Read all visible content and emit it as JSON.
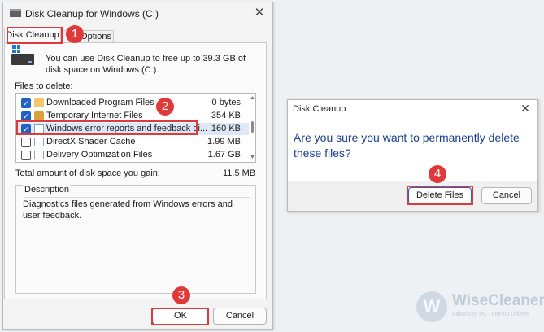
{
  "cleanup_window": {
    "title": "Disk Cleanup for Windows (C:)",
    "close_glyph": "✕",
    "tabs": [
      {
        "label": "Disk Cleanup",
        "active": true
      },
      {
        "label": "Options",
        "active": false
      }
    ],
    "intro_text": "You can use Disk Cleanup to free up to 39.3 GB of disk space on Windows (C:).",
    "files_to_delete_label": "Files to delete:",
    "files": [
      {
        "name": "Downloaded Program Files",
        "size": "0 bytes",
        "checked": true,
        "icon": "folder-icon"
      },
      {
        "name": "Temporary Internet Files",
        "size": "354 KB",
        "checked": true,
        "icon": "lock-icon"
      },
      {
        "name": "Windows error reports and feedback di...",
        "size": "160 KB",
        "checked": true,
        "icon": "page-icon",
        "selected": true
      },
      {
        "name": "DirectX Shader Cache",
        "size": "1.99 MB",
        "checked": false,
        "icon": "page-icon"
      },
      {
        "name": "Delivery Optimization Files",
        "size": "1.67 GB",
        "checked": false,
        "icon": "page-icon"
      }
    ],
    "total_label": "Total amount of disk space you gain:",
    "total_value": "11.5 MB",
    "description_legend": "Description",
    "description_text": "Diagnostics files generated from Windows errors and user feedback.",
    "ok_label": "OK",
    "cancel_label": "Cancel"
  },
  "confirm_dialog": {
    "title": "Disk Cleanup",
    "close_glyph": "✕",
    "question": "Are you sure you want to permanently delete these files?",
    "delete_label": "Delete Files",
    "cancel_label": "Cancel"
  },
  "step_badges": [
    "1",
    "2",
    "3",
    "4"
  ],
  "watermark": {
    "logo_letter": "W",
    "name": "WiseCleaner",
    "tagline": "Advanced PC Tune-up Utilities"
  },
  "colors": {
    "highlight": "#e0393a",
    "accent": "#1f62c4",
    "question_text": "#1a3f8f"
  }
}
